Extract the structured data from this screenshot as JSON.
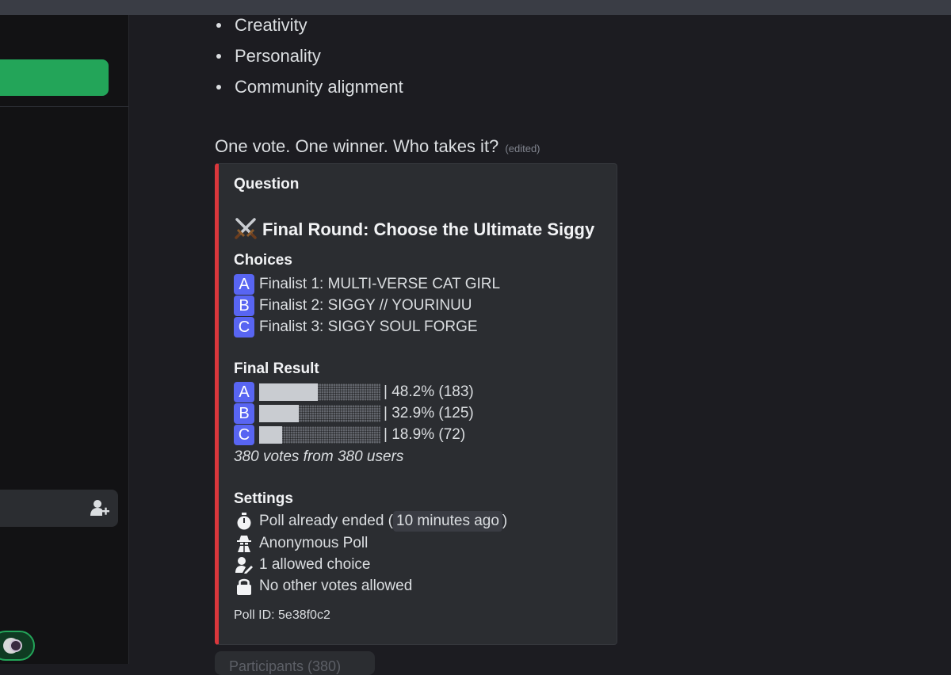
{
  "bullets": [
    "Creativity",
    "Personality",
    "Community alignment"
  ],
  "message": {
    "text": "One vote. One winner. Who takes it?",
    "edited": "(edited)"
  },
  "poll": {
    "question_header": "Question",
    "title": "Final Round: Choose the Ultimate Siggy",
    "title_icon": "crossed-swords-icon",
    "choices_header": "Choices",
    "choices": [
      {
        "letter": "A",
        "label": "Finalist 1: MULTI-VERSE CAT GIRL"
      },
      {
        "letter": "B",
        "label": "Finalist 2: SIGGY // YOURINUU"
      },
      {
        "letter": "C",
        "label": "Finalist 3: SIGGY SOUL FORGE"
      }
    ],
    "result_header": "Final Result",
    "results": [
      {
        "letter": "A",
        "fraction": 0.482,
        "text": "| 48.2% (183)"
      },
      {
        "letter": "B",
        "fraction": 0.329,
        "text": "| 32.9% (125)"
      },
      {
        "letter": "C",
        "fraction": 0.189,
        "text": "| 18.9% (72)"
      }
    ],
    "votes_summary": "380 votes from 380 users",
    "settings_header": "Settings",
    "settings": {
      "ended_prefix": "Poll already ended (",
      "ended_time": "10 minutes ago",
      "ended_suffix": ")",
      "anonymous": "Anonymous Poll",
      "allowed": "1 allowed choice",
      "no_other": "No other votes allowed"
    },
    "poll_id": "Poll ID: 5e38f0c2"
  },
  "below_button": "Participants (380)",
  "colors": {
    "accent_red": "#da373c",
    "letter_badge": "#5865f2",
    "green": "#23a559",
    "embed_bg": "#2b2d31"
  }
}
